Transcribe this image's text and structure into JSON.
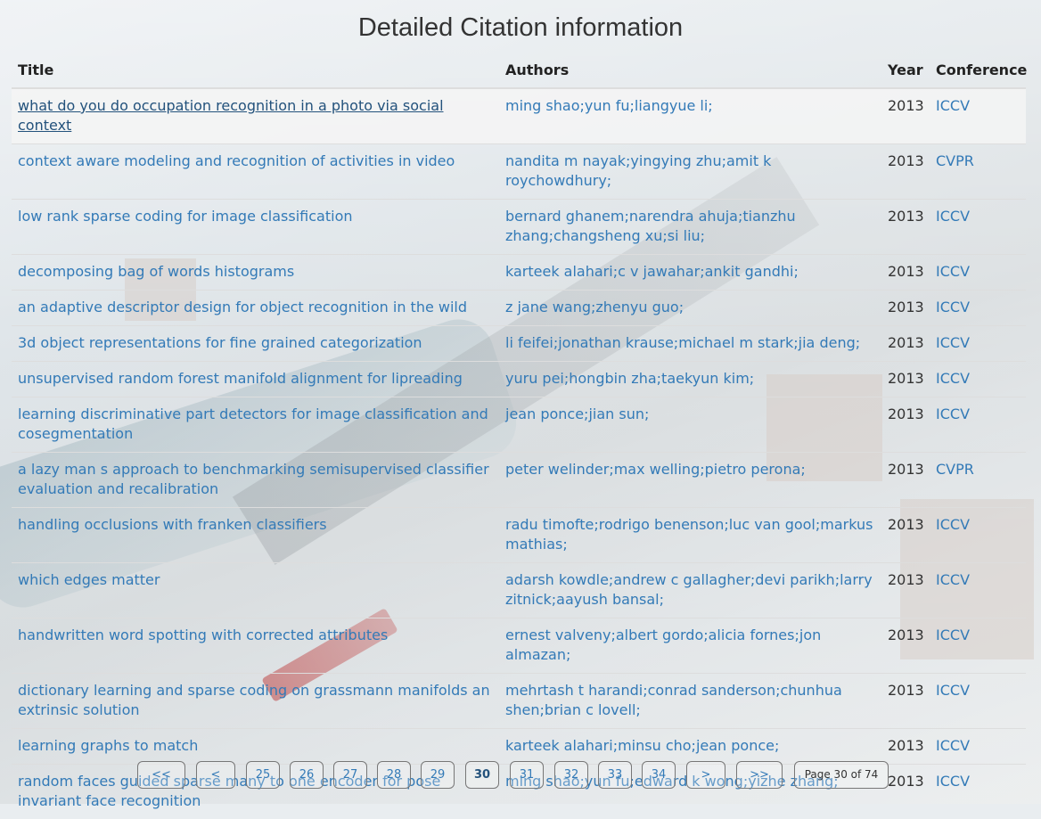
{
  "page_title": "Detailed Citation information",
  "columns": {
    "title": "Title",
    "authors": "Authors",
    "year": "Year",
    "conference": "Conference"
  },
  "rows": [
    {
      "title": "what do you do occupation recognition in a photo via social context",
      "authors": "ming shao;yun fu;liangyue li;",
      "year": "2013",
      "conference": "ICCV"
    },
    {
      "title": "context aware modeling and recognition of activities in video",
      "authors": "nandita m nayak;yingying zhu;amit k roychowdhury;",
      "year": "2013",
      "conference": "CVPR"
    },
    {
      "title": "low rank sparse coding for image classification",
      "authors": "bernard ghanem;narendra ahuja;tianzhu zhang;changsheng xu;si liu;",
      "year": "2013",
      "conference": "ICCV"
    },
    {
      "title": "decomposing bag of words histograms",
      "authors": "karteek alahari;c v jawahar;ankit gandhi;",
      "year": "2013",
      "conference": "ICCV"
    },
    {
      "title": "an adaptive descriptor design for object recognition in the wild",
      "authors": "z jane wang;zhenyu guo;",
      "year": "2013",
      "conference": "ICCV"
    },
    {
      "title": "3d object representations for fine grained categorization",
      "authors": "li feifei;jonathan krause;michael m stark;jia deng;",
      "year": "2013",
      "conference": "ICCV"
    },
    {
      "title": "unsupervised random forest manifold alignment for lipreading",
      "authors": "yuru pei;hongbin zha;taekyun kim;",
      "year": "2013",
      "conference": "ICCV"
    },
    {
      "title": "learning discriminative part detectors for image classification and cosegmentation",
      "authors": "jean ponce;jian sun;",
      "year": "2013",
      "conference": "ICCV"
    },
    {
      "title": "a lazy man s approach to benchmarking semisupervised classifier evaluation and recalibration",
      "authors": "peter welinder;max welling;pietro perona;",
      "year": "2013",
      "conference": "CVPR"
    },
    {
      "title": "handling occlusions with franken classifiers",
      "authors": "radu timofte;rodrigo benenson;luc van gool;markus mathias;",
      "year": "2013",
      "conference": "ICCV"
    },
    {
      "title": "which edges matter",
      "authors": "adarsh kowdle;andrew c gallagher;devi parikh;larry zitnick;aayush bansal;",
      "year": "2013",
      "conference": "ICCV"
    },
    {
      "title": "handwritten word spotting with corrected attributes",
      "authors": "ernest valveny;albert gordo;alicia fornes;jon almazan;",
      "year": "2013",
      "conference": "ICCV"
    },
    {
      "title": "dictionary learning and sparse coding on grassmann manifolds an extrinsic solution",
      "authors": "mehrtash t harandi;conrad sanderson;chunhua shen;brian c lovell;",
      "year": "2013",
      "conference": "ICCV"
    },
    {
      "title": "learning graphs to match",
      "authors": "karteek alahari;minsu cho;jean ponce;",
      "year": "2013",
      "conference": "ICCV"
    },
    {
      "title": "random faces guided sparse many to one encoder for pose invariant face recognition",
      "authors": "ming shao;yun fu;edward k wong;yizhe zhang;",
      "year": "2013",
      "conference": "ICCV"
    }
  ],
  "pagination": {
    "first": "<<",
    "prev": "<",
    "pages": [
      "25",
      "26",
      "27",
      "28",
      "29",
      "30",
      "31",
      "32",
      "33",
      "34"
    ],
    "current": "30",
    "next": ">",
    "last": ">>",
    "info": "Page 30 of 74"
  },
  "colors": {
    "link": "#337ab7",
    "text": "#333333"
  }
}
